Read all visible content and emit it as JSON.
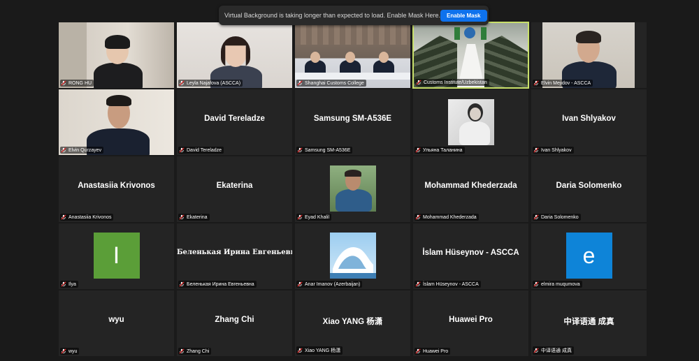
{
  "notification": {
    "message": "Virtual Background is taking longer than expected to load. Enable Mask Here.",
    "button": "Enable Mask"
  },
  "participants": [
    {
      "label": "RONG HU"
    },
    {
      "label": "Leyla Najafova (ASCCA)"
    },
    {
      "label": "Shanghai Customs College"
    },
    {
      "label": "Customs Institute/Uzbekistan"
    },
    {
      "label": "Elvin Mejidov - ASCCA"
    },
    {
      "label": "Elvin Qurzayev"
    },
    {
      "display": "David Tereladze",
      "label": "David Tereladze"
    },
    {
      "display": "Samsung SM-A536E",
      "label": "Samsung SM-A536E"
    },
    {
      "label": "Ульяна Таланина"
    },
    {
      "display": "Ivan Shlyakov",
      "label": "Ivan Shlyakov"
    },
    {
      "display": "Anastasiia Krivonos",
      "label": "Anastasiia Krivonos"
    },
    {
      "display": "Ekaterina",
      "label": "Ekaterina"
    },
    {
      "label": "Eyad Khalil"
    },
    {
      "display": "Mohammad Khederzada",
      "label": "Mohammad Khederzada"
    },
    {
      "display": "Daria Solomenko",
      "label": "Daria Solomenko"
    },
    {
      "avatar_letter": "I",
      "label": "Ilya"
    },
    {
      "display": "Беленькая Ирина Евгеньевна",
      "label": "Беленькая Ирина Евгеньевна"
    },
    {
      "label": "Anar Imanov (Azerbaijan)"
    },
    {
      "display": "İslam Hüseynov - ASCCA",
      "label": "İslam Hüseynov - ASCCA"
    },
    {
      "avatar_letter": "e",
      "label": "elmira muqumova"
    },
    {
      "display": "wyu",
      "label": "wyu"
    },
    {
      "display": "Zhang Chi",
      "label": "Zhang Chi"
    },
    {
      "display": "Xiao YANG 杨潇",
      "label": "Xiao YANG 杨潇"
    },
    {
      "display": "Huawei Pro",
      "label": "Huawei Pro"
    },
    {
      "display": "中译语通 成真",
      "label": "中译语通 成真"
    }
  ],
  "colors": {
    "accent": "#0e72ed",
    "active_speaker": "#c8e06a",
    "muted_icon": "#e02828",
    "avatar_green": "#5b9e38",
    "avatar_blue": "#0e84d8"
  }
}
